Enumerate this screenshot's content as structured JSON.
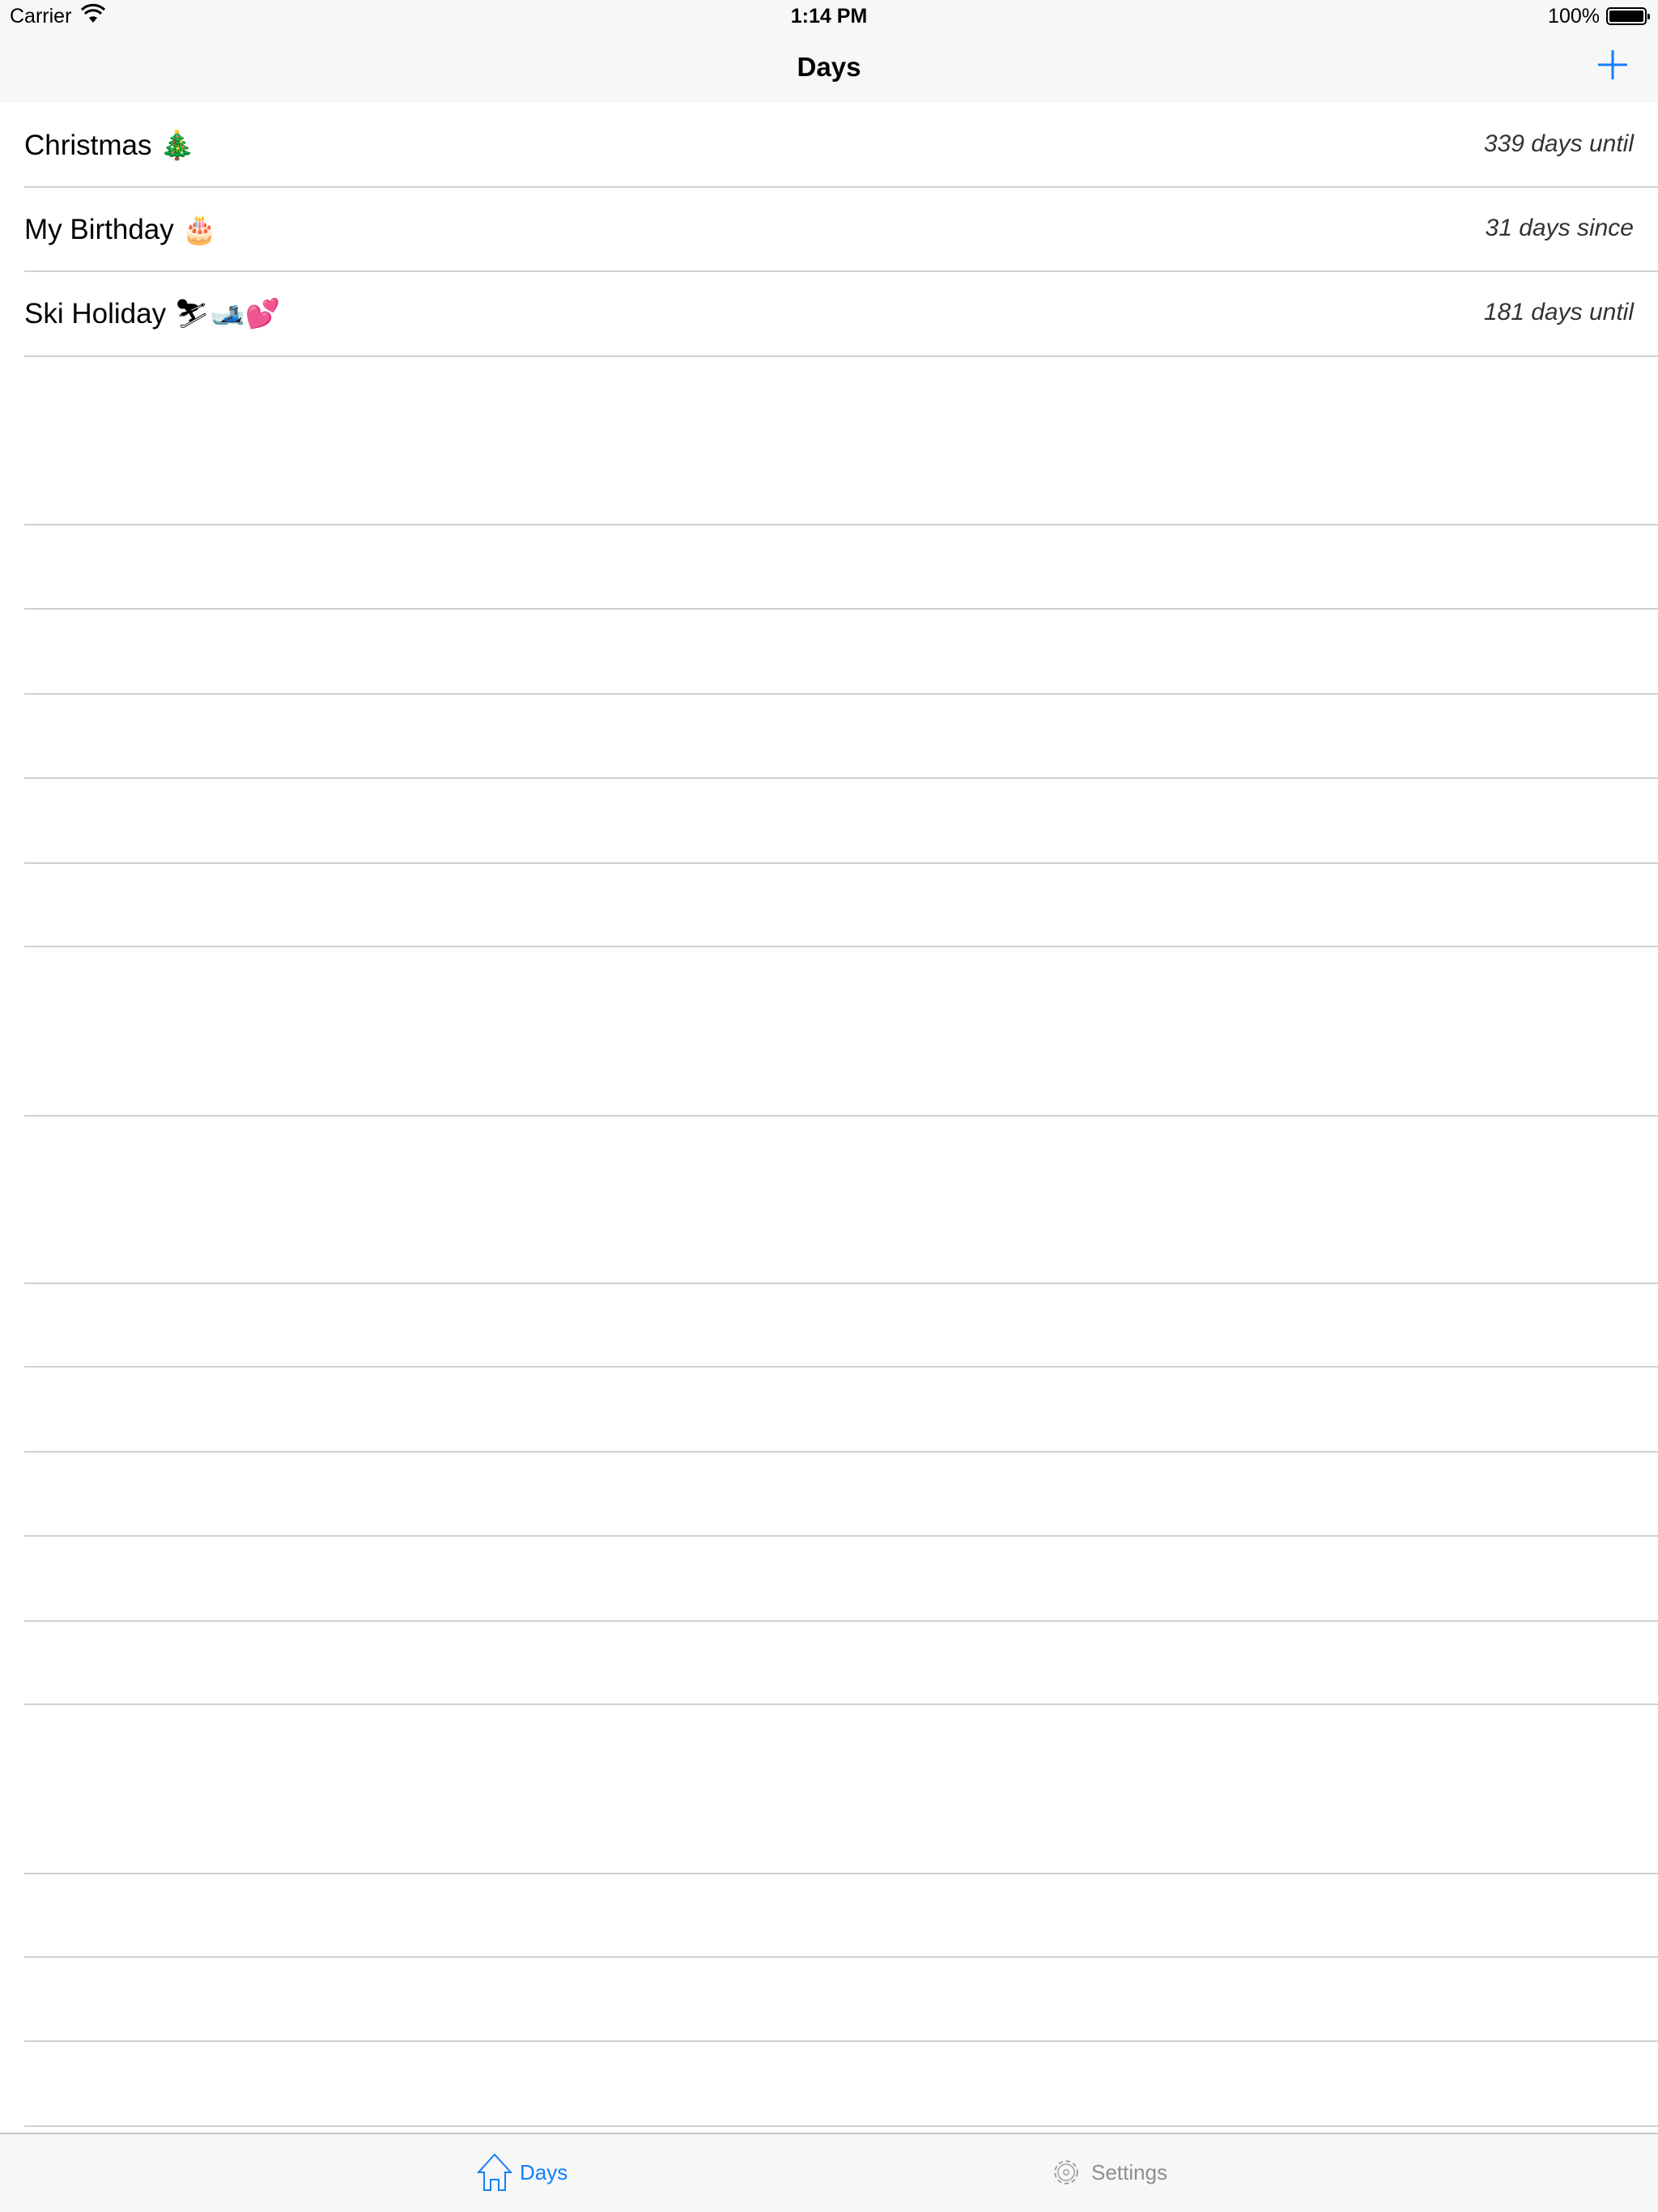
{
  "status_bar": {
    "carrier": "Carrier",
    "time": "1:14 PM",
    "battery": "100%"
  },
  "nav": {
    "title": "Days",
    "add_icon": "plus-icon"
  },
  "events": [
    {
      "name": "Christmas 🎄",
      "count": "339 days until"
    },
    {
      "name": "My Birthday 🎂",
      "count": "31 days since"
    },
    {
      "name": "Ski Holiday ⛷🎿💕",
      "count": "181 days until"
    }
  ],
  "tabs": [
    {
      "label": "Days",
      "icon": "house-icon",
      "selected": true
    },
    {
      "label": "Settings",
      "icon": "gear-icon",
      "selected": false
    }
  ],
  "colors": {
    "accent": "#147efb",
    "inactive": "#8e8e93"
  }
}
